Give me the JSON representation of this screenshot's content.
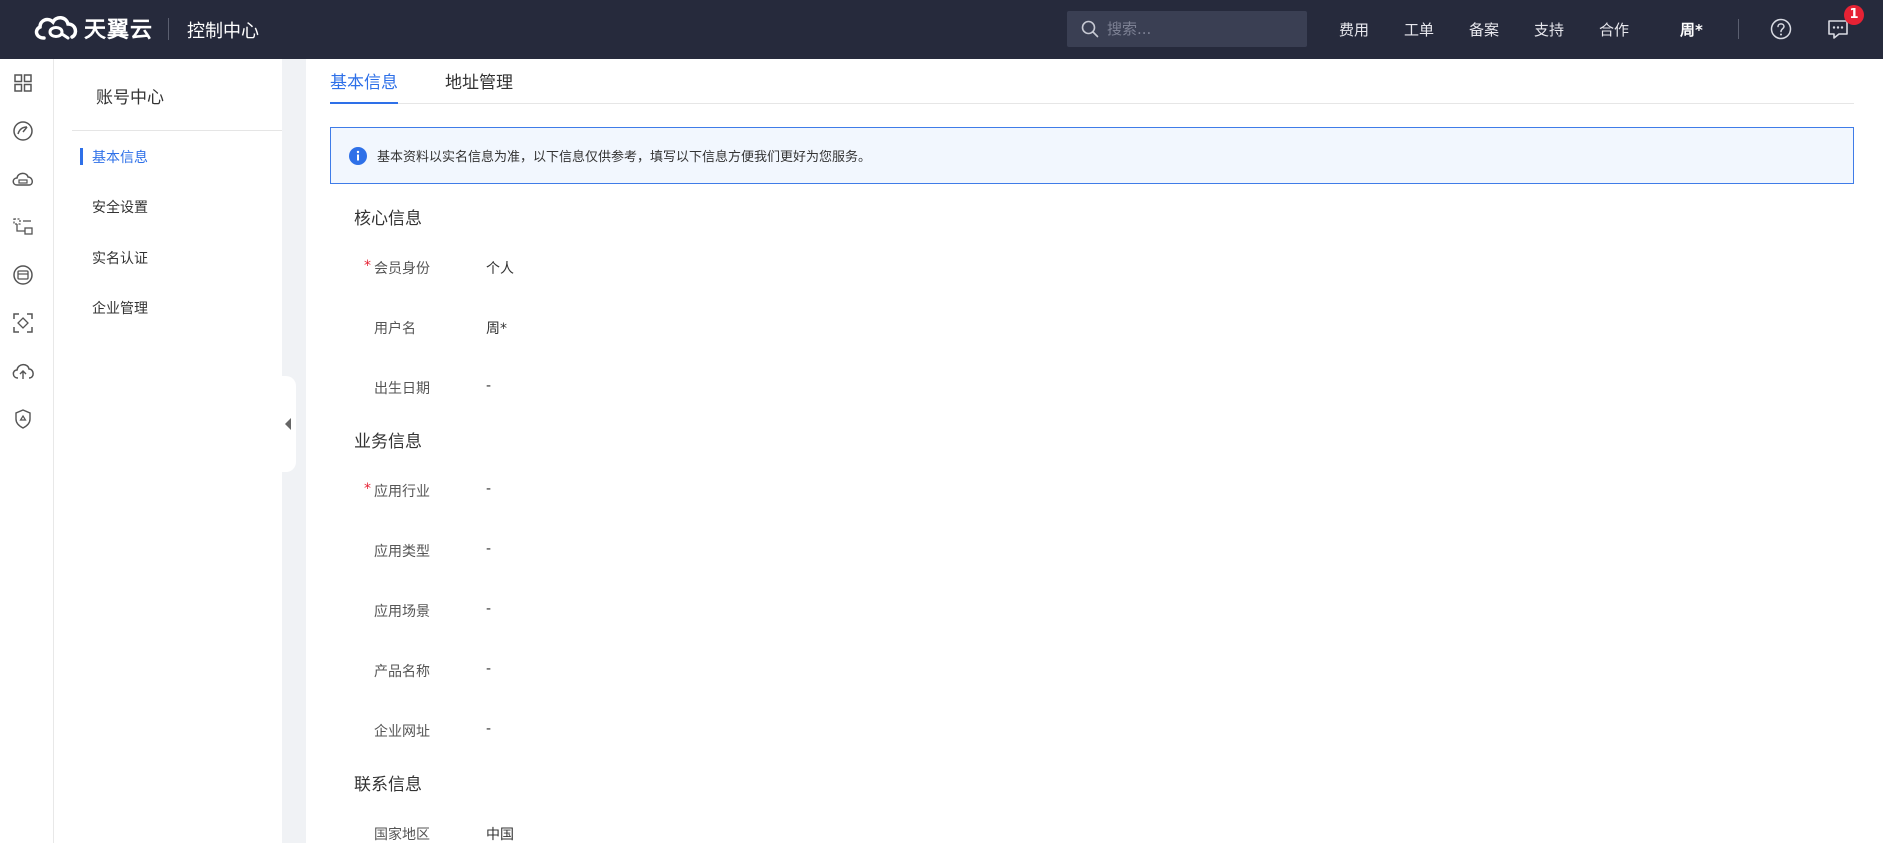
{
  "header": {
    "brand": "天翼云",
    "console_title": "控制中心",
    "search_placeholder": "搜索...",
    "nav": [
      "费用",
      "工单",
      "备案",
      "支持",
      "合作"
    ],
    "user": "周*",
    "message_badge": "1",
    "accent": "#2e70e8"
  },
  "rail_icons": [
    "grid-icon",
    "dashboard-icon",
    "cloud-server-icon",
    "network-icon",
    "storage-icon",
    "scan-icon",
    "cloud-upload-icon",
    "security-icon"
  ],
  "subnav": {
    "title": "账号中心",
    "items": [
      {
        "label": "基本信息",
        "active": true
      },
      {
        "label": "安全设置",
        "active": false
      },
      {
        "label": "实名认证",
        "active": false
      },
      {
        "label": "企业管理",
        "active": false
      }
    ]
  },
  "tabs": [
    {
      "label": "基本信息",
      "active": true
    },
    {
      "label": "地址管理",
      "active": false
    }
  ],
  "notice": "基本资料以实名信息为准，以下信息仅供参考，填写以下信息方便我们更好为您服务。",
  "sections": {
    "core": {
      "title": "核心信息",
      "fields": [
        {
          "label": "会员身份",
          "value": "个人",
          "required": true
        },
        {
          "label": "用户名",
          "value": "周*",
          "required": false
        },
        {
          "label": "出生日期",
          "value": "-",
          "required": false
        }
      ]
    },
    "business": {
      "title": "业务信息",
      "fields": [
        {
          "label": "应用行业",
          "value": "-",
          "required": true
        },
        {
          "label": "应用类型",
          "value": "-",
          "required": false
        },
        {
          "label": "应用场景",
          "value": "-",
          "required": false
        },
        {
          "label": "产品名称",
          "value": "-",
          "required": false
        },
        {
          "label": "企业网址",
          "value": "-",
          "required": false
        }
      ]
    },
    "contact": {
      "title": "联系信息",
      "fields": [
        {
          "label": "国家地区",
          "value": "中国",
          "required": false
        }
      ]
    }
  }
}
